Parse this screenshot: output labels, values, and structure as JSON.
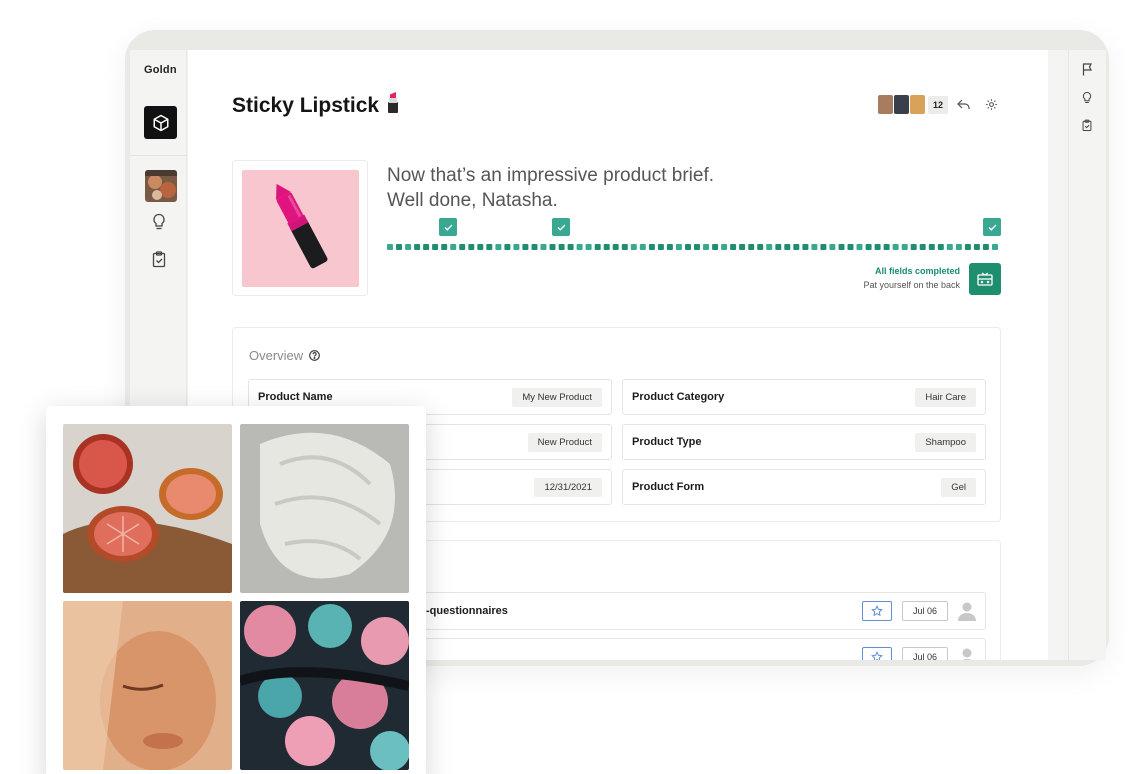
{
  "app": {
    "logo_text": "Goldn"
  },
  "header": {
    "title": "Sticky Lipstick",
    "title_emoji": "💄",
    "collaborator_count": "12"
  },
  "brief": {
    "message_line1": "Now that’s an impressive product brief.",
    "message_line2": "Well done, Natasha.",
    "status_title": "All fields completed",
    "status_subtitle": "Pat yourself on the back",
    "progress": 1.0
  },
  "overview": {
    "title": "Overview",
    "fields": [
      {
        "label": "Product Name",
        "value": "My New Product"
      },
      {
        "label": "Product Category",
        "value": "Hair Care"
      },
      {
        "label": "",
        "value": "New Product"
      },
      {
        "label": "Product Type",
        "value": "Shampoo"
      },
      {
        "label": "",
        "value": "12/31/2021"
      },
      {
        "label": "Product Form",
        "value": "Gel"
      }
    ]
  },
  "tasks": [
    {
      "label": "-questionnaires",
      "date": "Jul 06"
    },
    {
      "label": "",
      "date": "Jul 06"
    }
  ],
  "colors": {
    "accent": "#1f8e6f",
    "accent_light": "#38a890",
    "star_blue": "#5f8fd7"
  }
}
